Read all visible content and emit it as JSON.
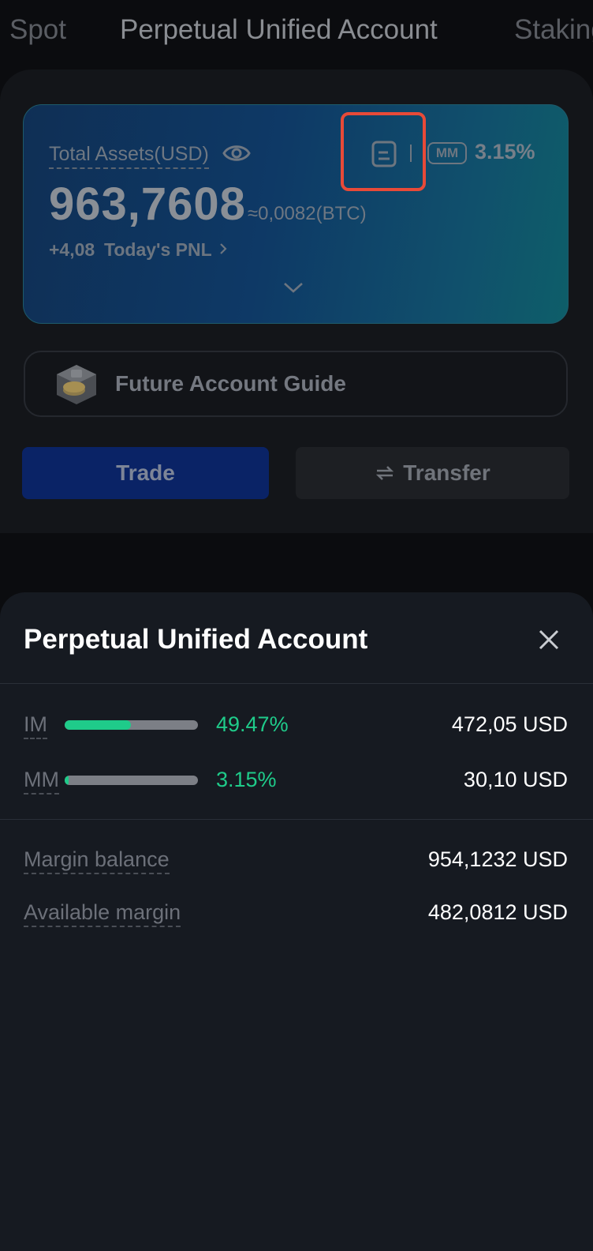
{
  "tabs": [
    {
      "label": "Spot"
    },
    {
      "label": "Perpetual Unified Account"
    },
    {
      "label": "Staking"
    }
  ],
  "card": {
    "total_assets_label": "Total Assets(USD)",
    "total_assets_value": "963,7608",
    "btc_equiv": "≈0,0082(BTC)",
    "pnl_value": "+4,08",
    "pnl_label": "Today's PNL",
    "mm_badge": "MM",
    "mm_value": "3.15%"
  },
  "guide": {
    "label": "Future Account Guide"
  },
  "actions": {
    "trade": "Trade",
    "transfer": "Transfer"
  },
  "sheet": {
    "title": "Perpetual Unified Account",
    "im": {
      "label": "IM",
      "percent": "49.47%",
      "fill": 0.4947,
      "amount": "472,05 USD"
    },
    "mm": {
      "label": "MM",
      "percent": "3.15%",
      "fill": 0.0315,
      "amount": "30,10 USD"
    },
    "margin_balance": {
      "label": "Margin balance",
      "value": "954,1232 USD"
    },
    "available_margin": {
      "label": "Available margin",
      "value": "482,0812 USD"
    }
  },
  "colors": {
    "accent_green": "#1fcb8a",
    "highlight_red": "#e84a38",
    "trade_blue": "#0a2366"
  }
}
